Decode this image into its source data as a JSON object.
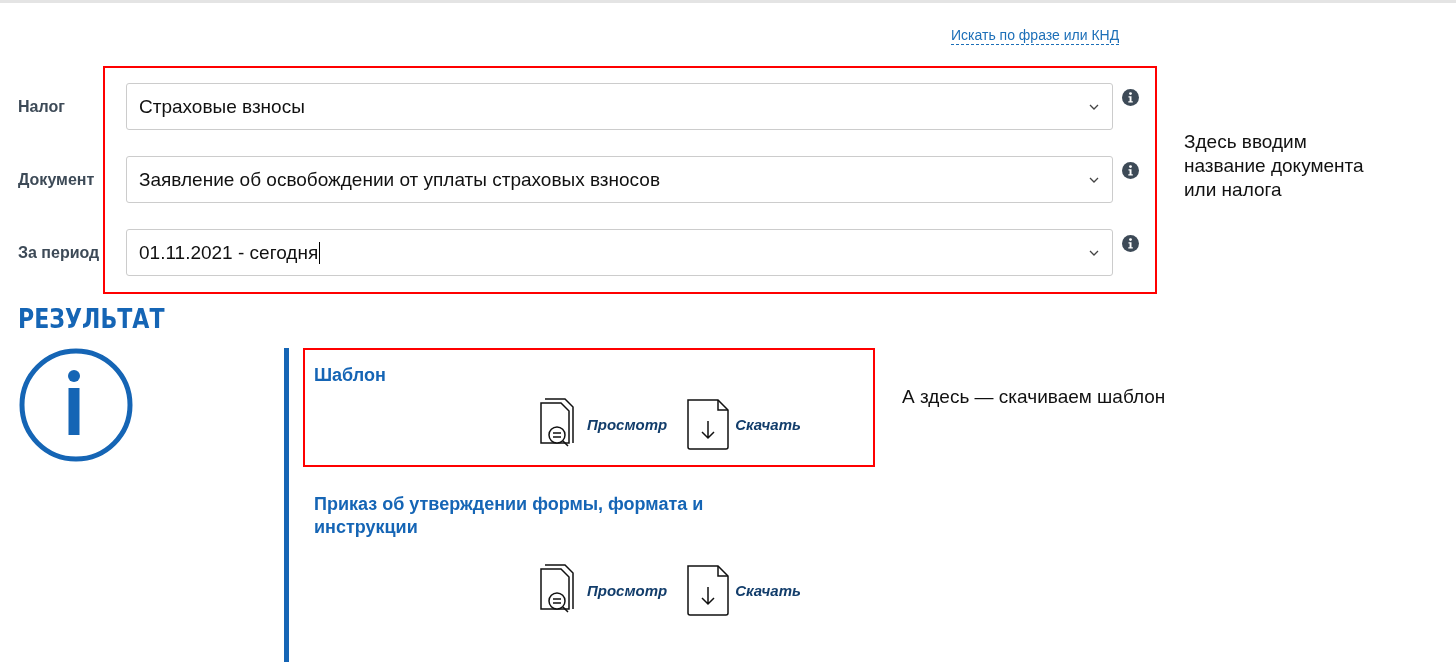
{
  "search_link": "Искать по фразе или КНД",
  "form": {
    "highlighted": true,
    "fields": [
      {
        "label": "Налог",
        "value": "Страховые взносы",
        "focused": false
      },
      {
        "label": "Документ",
        "value": "Заявление об освобождении от уплаты страховых взносов",
        "focused": false
      },
      {
        "label": "За период",
        "value": "01.11.2021 - сегодня",
        "focused": true
      }
    ]
  },
  "form_note": "Здесь вводим название документа или налога",
  "result": {
    "heading": "РЕЗУЛЬТАТ",
    "cards": [
      {
        "title": "Шаблон",
        "highlighted": true,
        "note": "А здесь — скачиваем шаблон",
        "actions": [
          {
            "kind": "view",
            "label": "Просмотр"
          },
          {
            "kind": "download",
            "label": "Скачать"
          }
        ]
      },
      {
        "title": "Приказ об утверждении формы, формата и инструкции",
        "highlighted": false,
        "actions": [
          {
            "kind": "view",
            "label": "Просмотр"
          },
          {
            "kind": "download",
            "label": "Скачать"
          }
        ]
      }
    ]
  }
}
